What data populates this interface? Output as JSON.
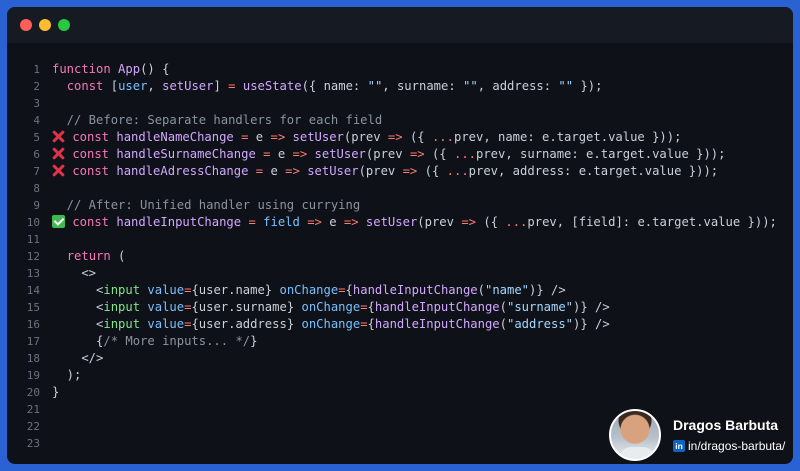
{
  "window": {
    "traffic_lights": [
      "close",
      "minimize",
      "maximize"
    ]
  },
  "code": {
    "lines": [
      {
        "n": "1",
        "tokens": [
          [
            "kw",
            "function "
          ],
          [
            "fn",
            "App"
          ],
          [
            "pl",
            "() {"
          ]
        ]
      },
      {
        "n": "2",
        "tokens": [
          [
            "pl",
            "  "
          ],
          [
            "kw",
            "const "
          ],
          [
            "pl",
            "["
          ],
          [
            "id",
            "user"
          ],
          [
            "pl",
            ", "
          ],
          [
            "fn",
            "setUser"
          ],
          [
            "pl",
            "] "
          ],
          [
            "op",
            "="
          ],
          [
            "pl",
            " "
          ],
          [
            "fn",
            "useState"
          ],
          [
            "pl",
            "({ name: "
          ],
          [
            "str",
            "\"\""
          ],
          [
            "pl",
            ", surname: "
          ],
          [
            "str",
            "\"\""
          ],
          [
            "pl",
            ", address: "
          ],
          [
            "str",
            "\"\""
          ],
          [
            "pl",
            " });"
          ]
        ]
      },
      {
        "n": "3",
        "tokens": []
      },
      {
        "n": "4",
        "tokens": [
          [
            "cm",
            "  // Before: Separate handlers for each field"
          ]
        ]
      },
      {
        "n": "5",
        "mark": "x",
        "tokens": [
          [
            "kw",
            " const "
          ],
          [
            "fn",
            "handleNameChange"
          ],
          [
            "pl",
            " "
          ],
          [
            "op",
            "="
          ],
          [
            "pl",
            " e "
          ],
          [
            "op",
            "=>"
          ],
          [
            "pl",
            " "
          ],
          [
            "fn",
            "setUser"
          ],
          [
            "pl",
            "(prev "
          ],
          [
            "op",
            "=>"
          ],
          [
            "pl",
            " ({ "
          ],
          [
            "op",
            "..."
          ],
          [
            "pl",
            "prev, name: e.target.value }));"
          ]
        ]
      },
      {
        "n": "6",
        "mark": "x",
        "tokens": [
          [
            "kw",
            " const "
          ],
          [
            "fn",
            "handleSurnameChange"
          ],
          [
            "pl",
            " "
          ],
          [
            "op",
            "="
          ],
          [
            "pl",
            " e "
          ],
          [
            "op",
            "=>"
          ],
          [
            "pl",
            " "
          ],
          [
            "fn",
            "setUser"
          ],
          [
            "pl",
            "(prev "
          ],
          [
            "op",
            "=>"
          ],
          [
            "pl",
            " ({ "
          ],
          [
            "op",
            "..."
          ],
          [
            "pl",
            "prev, surname: e.target.value }));"
          ]
        ]
      },
      {
        "n": "7",
        "mark": "x",
        "tokens": [
          [
            "kw",
            " const "
          ],
          [
            "fn",
            "handleAdressChange"
          ],
          [
            "pl",
            " "
          ],
          [
            "op",
            "="
          ],
          [
            "pl",
            " e "
          ],
          [
            "op",
            "=>"
          ],
          [
            "pl",
            " "
          ],
          [
            "fn",
            "setUser"
          ],
          [
            "pl",
            "(prev "
          ],
          [
            "op",
            "=>"
          ],
          [
            "pl",
            " ({ "
          ],
          [
            "op",
            "..."
          ],
          [
            "pl",
            "prev, address: e.target.value }));"
          ]
        ]
      },
      {
        "n": "8",
        "tokens": []
      },
      {
        "n": "9",
        "tokens": [
          [
            "cm",
            "  // After: Unified handler using currying"
          ]
        ]
      },
      {
        "n": "10",
        "mark": "check",
        "tokens": [
          [
            "kw",
            " const "
          ],
          [
            "fn",
            "handleInputChange"
          ],
          [
            "pl",
            " "
          ],
          [
            "op",
            "="
          ],
          [
            "pl",
            " "
          ],
          [
            "id",
            "field"
          ],
          [
            "pl",
            " "
          ],
          [
            "op",
            "=>"
          ],
          [
            "pl",
            " e "
          ],
          [
            "op",
            "=>"
          ],
          [
            "pl",
            " "
          ],
          [
            "fn",
            "setUser"
          ],
          [
            "pl",
            "(prev "
          ],
          [
            "op",
            "=>"
          ],
          [
            "pl",
            " ({ "
          ],
          [
            "op",
            "..."
          ],
          [
            "pl",
            "prev, [field]: e.target.value }));"
          ]
        ]
      },
      {
        "n": "11",
        "tokens": []
      },
      {
        "n": "12",
        "tokens": [
          [
            "pl",
            "  "
          ],
          [
            "kw",
            "return"
          ],
          [
            "pl",
            " ("
          ]
        ]
      },
      {
        "n": "13",
        "tokens": [
          [
            "pl",
            "    <>"
          ]
        ]
      },
      {
        "n": "14",
        "tokens": [
          [
            "pl",
            "      <"
          ],
          [
            "tag",
            "input"
          ],
          [
            "pl",
            " "
          ],
          [
            "attr",
            "value"
          ],
          [
            "op",
            "="
          ],
          [
            "pl",
            "{user.name} "
          ],
          [
            "attr",
            "onChange"
          ],
          [
            "op",
            "="
          ],
          [
            "pl",
            "{"
          ],
          [
            "fn",
            "handleInputChange"
          ],
          [
            "pl",
            "("
          ],
          [
            "str",
            "\"name\""
          ],
          [
            "pl",
            ")} />"
          ]
        ]
      },
      {
        "n": "15",
        "tokens": [
          [
            "pl",
            "      <"
          ],
          [
            "tag",
            "input"
          ],
          [
            "pl",
            " "
          ],
          [
            "attr",
            "value"
          ],
          [
            "op",
            "="
          ],
          [
            "pl",
            "{user.surname} "
          ],
          [
            "attr",
            "onChange"
          ],
          [
            "op",
            "="
          ],
          [
            "pl",
            "{"
          ],
          [
            "fn",
            "handleInputChange"
          ],
          [
            "pl",
            "("
          ],
          [
            "str",
            "\"surname\""
          ],
          [
            "pl",
            ")} />"
          ]
        ]
      },
      {
        "n": "16",
        "tokens": [
          [
            "pl",
            "      <"
          ],
          [
            "tag",
            "input"
          ],
          [
            "pl",
            " "
          ],
          [
            "attr",
            "value"
          ],
          [
            "op",
            "="
          ],
          [
            "pl",
            "{user.address} "
          ],
          [
            "attr",
            "onChange"
          ],
          [
            "op",
            "="
          ],
          [
            "pl",
            "{"
          ],
          [
            "fn",
            "handleInputChange"
          ],
          [
            "pl",
            "("
          ],
          [
            "str",
            "\"address\""
          ],
          [
            "pl",
            ")} />"
          ]
        ]
      },
      {
        "n": "17",
        "tokens": [
          [
            "pl",
            "      {"
          ],
          [
            "cm",
            "/* More inputs... */"
          ],
          [
            "pl",
            "}"
          ]
        ]
      },
      {
        "n": "18",
        "tokens": [
          [
            "pl",
            "    </>"
          ]
        ]
      },
      {
        "n": "19",
        "tokens": [
          [
            "pl",
            "  );"
          ]
        ]
      },
      {
        "n": "20",
        "tokens": [
          [
            "pl",
            "}"
          ]
        ]
      },
      {
        "n": "21",
        "tokens": []
      },
      {
        "n": "22",
        "tokens": []
      },
      {
        "n": "23",
        "tokens": []
      }
    ]
  },
  "author": {
    "name": "Dragos Barbuta",
    "linkedin_label": "in",
    "handle": "in/dragos-barbuta/",
    "avatar_icon": "person-photo"
  },
  "colors": {
    "background": "#2a62d4",
    "editor_bg": "#0e1117",
    "bad_mark": "#e0334a",
    "good_mark": "#3fb950"
  }
}
